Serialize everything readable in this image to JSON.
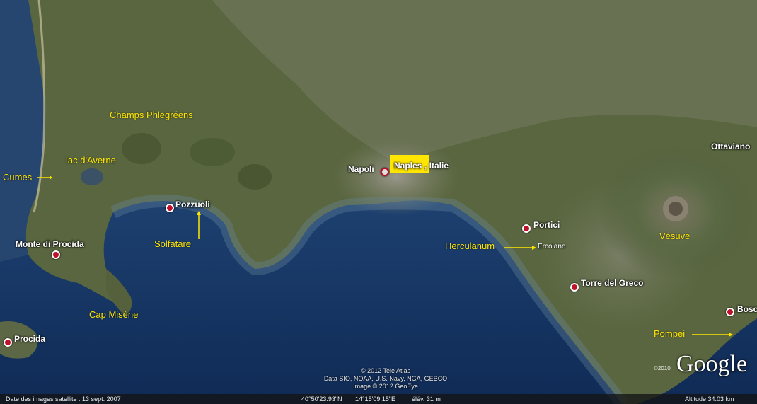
{
  "labels": {
    "champs": "Champs Phlégréens",
    "averne": "lac d'Averne",
    "cumes": "Cumes",
    "pozzuoli": "Pozzuoli",
    "solfatare": "Solfatare",
    "monte_procida": "Monte di Procida",
    "cap_misene": "Cap Misène",
    "procida": "Procida",
    "napoli": "Napoli",
    "naples": "Naples",
    "italie": ", Italie",
    "ottaviano": "Ottaviano",
    "portici": "Portici",
    "herculanum": "Herculanum",
    "ercolano": "Ercolano",
    "vesuve": "Vésuve",
    "torre_greco": "Torre del Greco",
    "bosco": "Bosc",
    "pompei": "Pompei"
  },
  "attribution": {
    "line1": "© 2012 Tele Atlas",
    "line2": "Data SIO, NOAA, U.S. Navy, NGA, GEBCO",
    "line3": "Image © 2012 GeoEye"
  },
  "status": {
    "imagery_date": "Date des images satellite : 13 sept. 2007",
    "lat": "40°50'23.93\"N",
    "lon": "14°15'09.15\"E",
    "elev": "élév.  31 m",
    "altitude": "Altitude   34.03 km"
  },
  "logo": {
    "year": "©2010",
    "text": "Google"
  },
  "colors": {
    "label_yellow": "#ffe600",
    "pin_red": "#c0112a",
    "sea": "#1d3f73",
    "land": "#5e6b4a"
  }
}
